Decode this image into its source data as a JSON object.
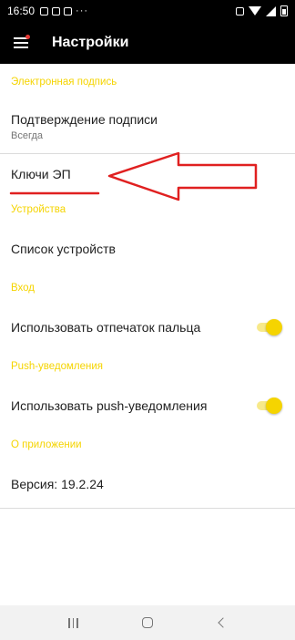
{
  "status_bar": {
    "time": "16:50",
    "ellipsis": "···"
  },
  "app_bar": {
    "title": "Настройки"
  },
  "sections": {
    "signature": {
      "header": "Электронная подпись",
      "confirm_title": "Подтверждение подписи",
      "confirm_value": "Всегда",
      "keys_title": "Ключи ЭП"
    },
    "devices": {
      "header": "Устройства",
      "list_title": "Список устройств"
    },
    "login": {
      "header": "Вход",
      "fingerprint_title": "Использовать отпечаток пальца",
      "fingerprint_enabled": true
    },
    "push": {
      "header": "Push-уведомления",
      "push_title": "Использовать push-уведомления",
      "push_enabled": true
    },
    "about": {
      "header": "О приложении",
      "version_text": "Версия: 19.2.24"
    }
  },
  "colors": {
    "accent": "#f5d400",
    "annotation": "#e02020",
    "bar_background": "#000000"
  },
  "icons": {
    "menu": "hamburger-menu-icon",
    "recents": "recents-icon",
    "home": "home-icon",
    "back": "back-icon"
  }
}
